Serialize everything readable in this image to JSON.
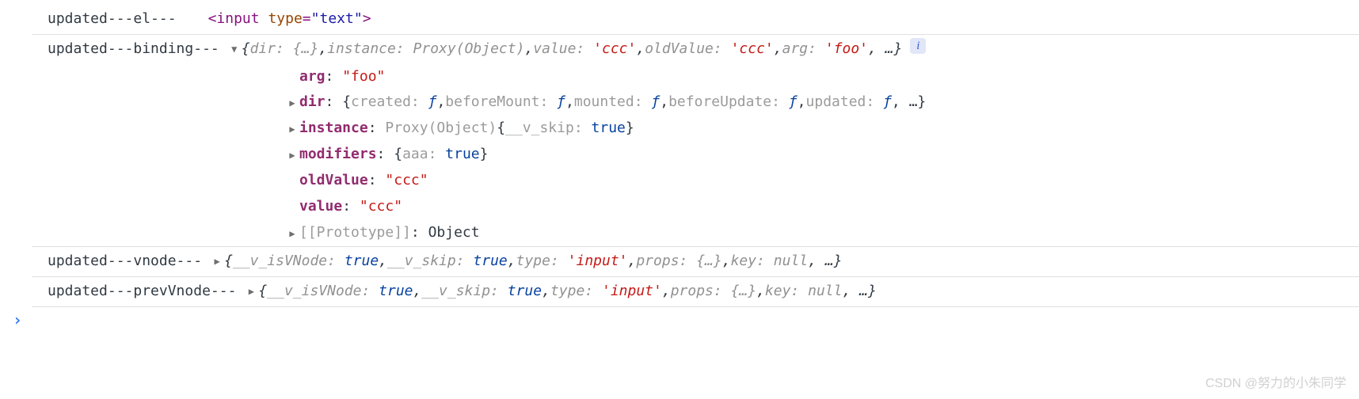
{
  "rows": {
    "el": {
      "label": "updated---el---",
      "tag_open": "<",
      "tag_name": "input",
      "attr_name": "type",
      "eq": "=",
      "q": "\"",
      "attr_val": "text",
      "tag_close": ">"
    },
    "binding": {
      "label": "updated---binding---",
      "summary": {
        "open": "{",
        "k1": "dir:",
        "v1": "{…}",
        "sep": ", ",
        "k2": "instance:",
        "v2": "Proxy(Object)",
        "k3": "value:",
        "v3": "'ccc'",
        "k4": "oldValue:",
        "v4": "'ccc'",
        "k5": "arg:",
        "v5": "'foo'",
        "ellipsis": ", …",
        "close": "}"
      },
      "info": "i",
      "expanded": {
        "arg": {
          "key": "arg",
          "val": "\"foo\""
        },
        "dir": {
          "key": "dir",
          "open": "{",
          "p1k": "created:",
          "p1v": "ƒ",
          "p2k": "beforeMount:",
          "p2v": "ƒ",
          "p3k": "mounted:",
          "p3v": "ƒ",
          "p4k": "beforeUpdate:",
          "p4v": "ƒ",
          "p5k": "updated:",
          "p5v": "ƒ",
          "ellipsis": ", …",
          "close": "}",
          "sep": ", "
        },
        "instance": {
          "key": "instance",
          "prefix": "Proxy(Object) ",
          "open": "{",
          "pk": "__v_skip:",
          "pv": "true",
          "close": "}"
        },
        "modifiers": {
          "key": "modifiers",
          "open": "{",
          "pk": "aaa:",
          "pv": "true",
          "close": "}"
        },
        "oldValue": {
          "key": "oldValue",
          "val": "\"ccc\""
        },
        "value": {
          "key": "value",
          "val": "\"ccc\""
        },
        "proto": {
          "key": "[[Prototype]]",
          "val": "Object"
        }
      }
    },
    "vnode": {
      "label": "updated---vnode---",
      "summary": {
        "open": "{",
        "k1": "__v_isVNode:",
        "v1": "true",
        "sep": ", ",
        "k2": "__v_skip:",
        "v2": "true",
        "k3": "type:",
        "v3": "'input'",
        "k4": "props:",
        "v4": "{…}",
        "k5": "key:",
        "v5": "null",
        "ellipsis": ", …",
        "close": "}"
      }
    },
    "prevVnode": {
      "label": "updated---prevVnode---",
      "summary": {
        "open": "{",
        "k1": "__v_isVNode:",
        "v1": "true",
        "sep": ", ",
        "k2": "__v_skip:",
        "v2": "true",
        "k3": "type:",
        "v3": "'input'",
        "k4": "props:",
        "v4": "{…}",
        "k5": "key:",
        "v5": "null",
        "ellipsis": ", …",
        "close": "}"
      }
    }
  },
  "prompt": "›",
  "watermark": "CSDN @努力的小朱同学",
  "glyphs": {
    "right": "▶",
    "down": "▼"
  }
}
